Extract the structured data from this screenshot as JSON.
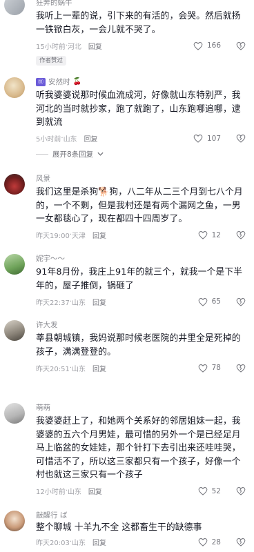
{
  "comments": [
    {
      "username": "狂奔的蜗牛",
      "text": "我听上一辈的说，引下来的有活的，会哭。然后就扬一铁锨白灰，一会儿就不哭了。",
      "time": "15小时前",
      "location": "河北",
      "reply_label": "回复",
      "likes": "166",
      "author_tag": "作者赞过"
    },
    {
      "username": "安然时",
      "badge": "⑪",
      "text": "听我婆婆说那时候血流成河，好像就山东特别严，我河北的当时就抄家，跑了就跑了，山东跑哪追哪，逮到就流",
      "time": "5小时前",
      "location": "山东",
      "reply_label": "回复",
      "likes": "107",
      "expand_label": "展开8条回复"
    },
    {
      "username": "风景",
      "text": "我们这里是杀狗🐕狗，八二年从二三个月到七八个月的，一个不剩，但是我村还是有两个漏网之鱼，一男一女都毯心了，现在都四十四周岁了。",
      "time": "昨天19:00",
      "location": "天津",
      "reply_label": "回复",
      "likes": "12"
    },
    {
      "username": "妮宇～～",
      "text": "91年8月份，我庄上91年的就三个，就我一个是下半年的，屋子推倒，锅砸了",
      "time": "昨天22:37",
      "location": "山东",
      "reply_label": "回复",
      "likes": "65"
    },
    {
      "username": "许大发",
      "text": "莘县朝城镇，我妈说那时候老医院的井里全是死掉的孩子，满满登登的。",
      "time": "昨天20:51",
      "location": "山东",
      "reply_label": "回复",
      "likes": "78"
    },
    {
      "username": "萌萌",
      "text": "我婆婆赶上了，和她两个关系好的邻居姐妹一起，我婆婆的五六个月男娃，最可惜的另外一个是已经足月马上临盆的女娃娃，那个针打下去引出来还哇哇哭，可惜活不了，所以这三家都只有一个孩子，好像一个村也就这三家只有一个孩子",
      "time": "12小时前",
      "location": "山东",
      "reply_label": "回复",
      "likes": "52"
    },
    {
      "username": "敲醒行 ば",
      "text": "整个聊城 十羊九不全 这都畜生干的缺德事",
      "time": "昨天20:03",
      "location": "山东",
      "reply_label": "回复",
      "likes": "28"
    }
  ],
  "colors": {
    "text": "#161823",
    "secondary": "#a0a1a7",
    "badge": "#6b5bd8"
  },
  "icons": [
    "heart-icon",
    "broken-heart-icon",
    "chevron-down-icon"
  ]
}
